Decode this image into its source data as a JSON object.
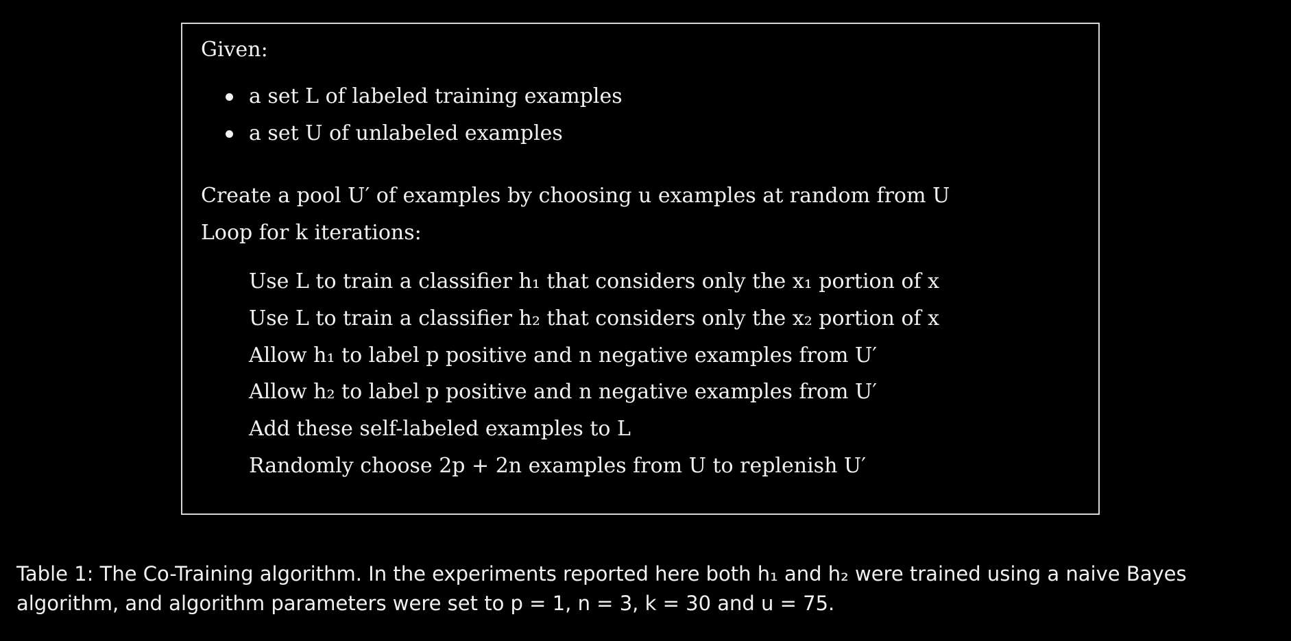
{
  "algorithm": {
    "given_label": "Given:",
    "given_items": [
      "a set L of labeled training examples",
      "a set U of unlabeled examples"
    ],
    "pool_line": "Create a pool U′ of examples by choosing u examples at random from U",
    "loop_line": "Loop for k iterations:",
    "loop_steps": [
      "Use L to train a classifier h₁ that considers only the x₁ portion of x",
      "Use L to train a classifier h₂ that considers only the x₂ portion of x",
      "Allow h₁ to label p positive and n negative examples from U′",
      "Allow h₂ to label p positive and n negative examples from U′",
      "Add these self-labeled examples to L",
      "Randomly choose 2p + 2n examples from U to replenish U′"
    ]
  },
  "caption": {
    "line1": "Table 1: The Co-Training algorithm. In the experiments reported here both h₁ and h₂ were trained using a naive Bayes",
    "line2": "algorithm, and algorithm parameters were set to p = 1, n = 3, k = 30 and u = 75."
  }
}
